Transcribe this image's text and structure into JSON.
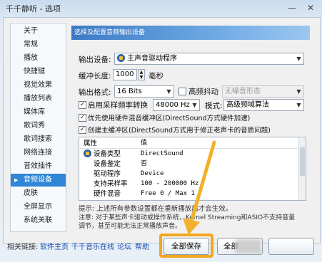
{
  "window": {
    "title": "千千静听 - 选项",
    "minimize": "—",
    "close": "✕"
  },
  "sidebar": {
    "items": [
      {
        "label": "关于"
      },
      {
        "label": "常规"
      },
      {
        "label": "播放"
      },
      {
        "label": "快捷键"
      },
      {
        "label": "视觉效果"
      },
      {
        "label": "播放列表"
      },
      {
        "label": "媒体库"
      },
      {
        "label": "歌词秀"
      },
      {
        "label": "歌词搜索"
      },
      {
        "label": "网络连接"
      },
      {
        "label": "音效插件"
      },
      {
        "label": "音频设备"
      },
      {
        "label": "皮肤"
      },
      {
        "label": "全屏显示"
      },
      {
        "label": "系统关联"
      }
    ],
    "active_index": 11
  },
  "header": {
    "text": "选择及配置音频输出设备"
  },
  "output": {
    "device_label": "输出设备:",
    "device_value": "主声音驱动程序",
    "buffer_label": "缓冲长度:",
    "buffer_value": "1000",
    "buffer_unit": "毫秒",
    "format_label": "输出格式:",
    "format_value": "16 Bits",
    "dither_label": "高频抖动",
    "dither_value": "无噪音形态",
    "resample_label": "启用采样频率转换",
    "resample_value": "48000 Hz",
    "mode_label": "模式:",
    "mode_value": "高级频域算法",
    "prefer_hw_label": "优先使用硬件混音缓冲区(DirectSound方式硬件加速)",
    "create_primary_label": "创建主缓冲区(DirectSound方式用于修正老声卡的音质问题)"
  },
  "properties": {
    "header_col1": "属性",
    "header_col2": "值",
    "rows": [
      {
        "name": "设备类型",
        "value": "DirectSound"
      },
      {
        "name": "设备鉴定",
        "value": "否"
      },
      {
        "name": "驱动程序",
        "value": "Device"
      },
      {
        "name": "支持采样率",
        "value": "100 - 200000 Hz"
      },
      {
        "name": "硬件混音",
        "value": "Free 0 / Max 1"
      }
    ]
  },
  "notes": {
    "line1": "提示: 上述所有参数设置都在重新播放后才会生效。",
    "line2": "注意: 对于某些声卡驱动或操作系统，Kernel Streaming和ASIO不支持音量",
    "line3": "调节，甚至可能无法正常播放声音。"
  },
  "footer": {
    "related_label": "相关链接:",
    "links": [
      "软件主页",
      "千千音乐在线",
      "论坛",
      "帮助"
    ],
    "save_all": "全部保存",
    "other_button": "全部"
  },
  "colors": {
    "accent": "#2f86d6",
    "highlight": "#f2a71f"
  },
  "icons": {
    "device": "speaker-device-icon",
    "check": "checkmark-icon"
  }
}
